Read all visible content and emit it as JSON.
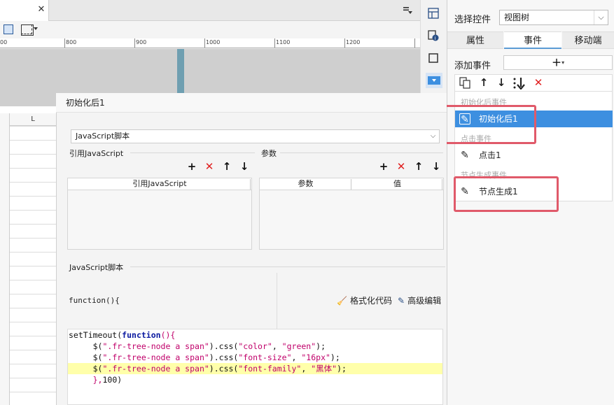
{
  "tabbar": {
    "close_glyph": "✕"
  },
  "ruler": {
    "labels": [
      "00",
      "800",
      "900",
      "1000",
      "1100",
      "1200"
    ]
  },
  "sheet": {
    "column_header": "L"
  },
  "right_panel": {
    "select_label": "选择控件",
    "select_value": "视图树",
    "tabs": [
      "属性",
      "事件",
      "移动端"
    ],
    "active_tab": "事件",
    "add_event_label": "添加事件",
    "add_event_glyph": "+",
    "event_toolbar": [
      "copy-icon",
      "arrow-up-icon",
      "arrow-down-icon",
      "move-bottom-icon",
      "delete-icon"
    ],
    "event_groups": [
      {
        "group": "初始化后事件",
        "item": "初始化后1",
        "selected": true
      },
      {
        "group": "点击事件",
        "item": "点击1",
        "selected": false
      },
      {
        "group": "节点生成事件",
        "item": "节点生成1",
        "selected": false
      }
    ]
  },
  "dialog": {
    "title": "初始化后1",
    "type_select": "JavaScript脚本",
    "ref_section_title": "引用JavaScript",
    "ref_table_header": "引用JavaScript",
    "param_section_title": "参数",
    "param_headers": [
      "参数",
      "值"
    ],
    "script_section_title": "JavaScript脚本",
    "function_signature": "function(){",
    "format_button": "格式化代码",
    "advanced_button": "高级编辑",
    "code_lines": [
      [
        {
          "t": "kw",
          "v": ""
        },
        {
          "t": "plain",
          "v": "setTimeout("
        },
        {
          "t": "kw",
          "v": "function"
        },
        {
          "t": "str",
          "v": "(){"
        }
      ],
      [
        {
          "t": "plain",
          "v": "     $("
        },
        {
          "t": "str",
          "v": "\".fr-tree-node a span\""
        },
        {
          "t": "plain",
          "v": ").css("
        },
        {
          "t": "str",
          "v": "\"color\""
        },
        {
          "t": "plain",
          "v": ", "
        },
        {
          "t": "str",
          "v": "\"green\""
        },
        {
          "t": "plain",
          "v": ");"
        }
      ],
      [
        {
          "t": "plain",
          "v": "     $("
        },
        {
          "t": "str",
          "v": "\".fr-tree-node a span\""
        },
        {
          "t": "plain",
          "v": ").css("
        },
        {
          "t": "str",
          "v": "\"font-size\""
        },
        {
          "t": "plain",
          "v": ", "
        },
        {
          "t": "str",
          "v": "\"16px\""
        },
        {
          "t": "plain",
          "v": ");"
        }
      ],
      [
        {
          "t": "plain",
          "v": "     $("
        },
        {
          "t": "str",
          "v": "\".fr-tree-node a span\""
        },
        {
          "t": "plain",
          "v": ").css("
        },
        {
          "t": "str",
          "v": "\"font-family\""
        },
        {
          "t": "plain",
          "v": ", "
        },
        {
          "t": "str",
          "v": "\"黑体\""
        },
        {
          "t": "plain",
          "v": ");"
        }
      ],
      [
        {
          "t": "str",
          "v": "     },"
        },
        {
          "t": "plain",
          "v": "100)"
        }
      ]
    ],
    "highlighted_line": 3
  },
  "colors": {
    "selected_row": "#3d8fe0",
    "highlight_box": "#e05a6a",
    "delete_red": "#e02020",
    "code_highlight": "#ffffaa"
  }
}
